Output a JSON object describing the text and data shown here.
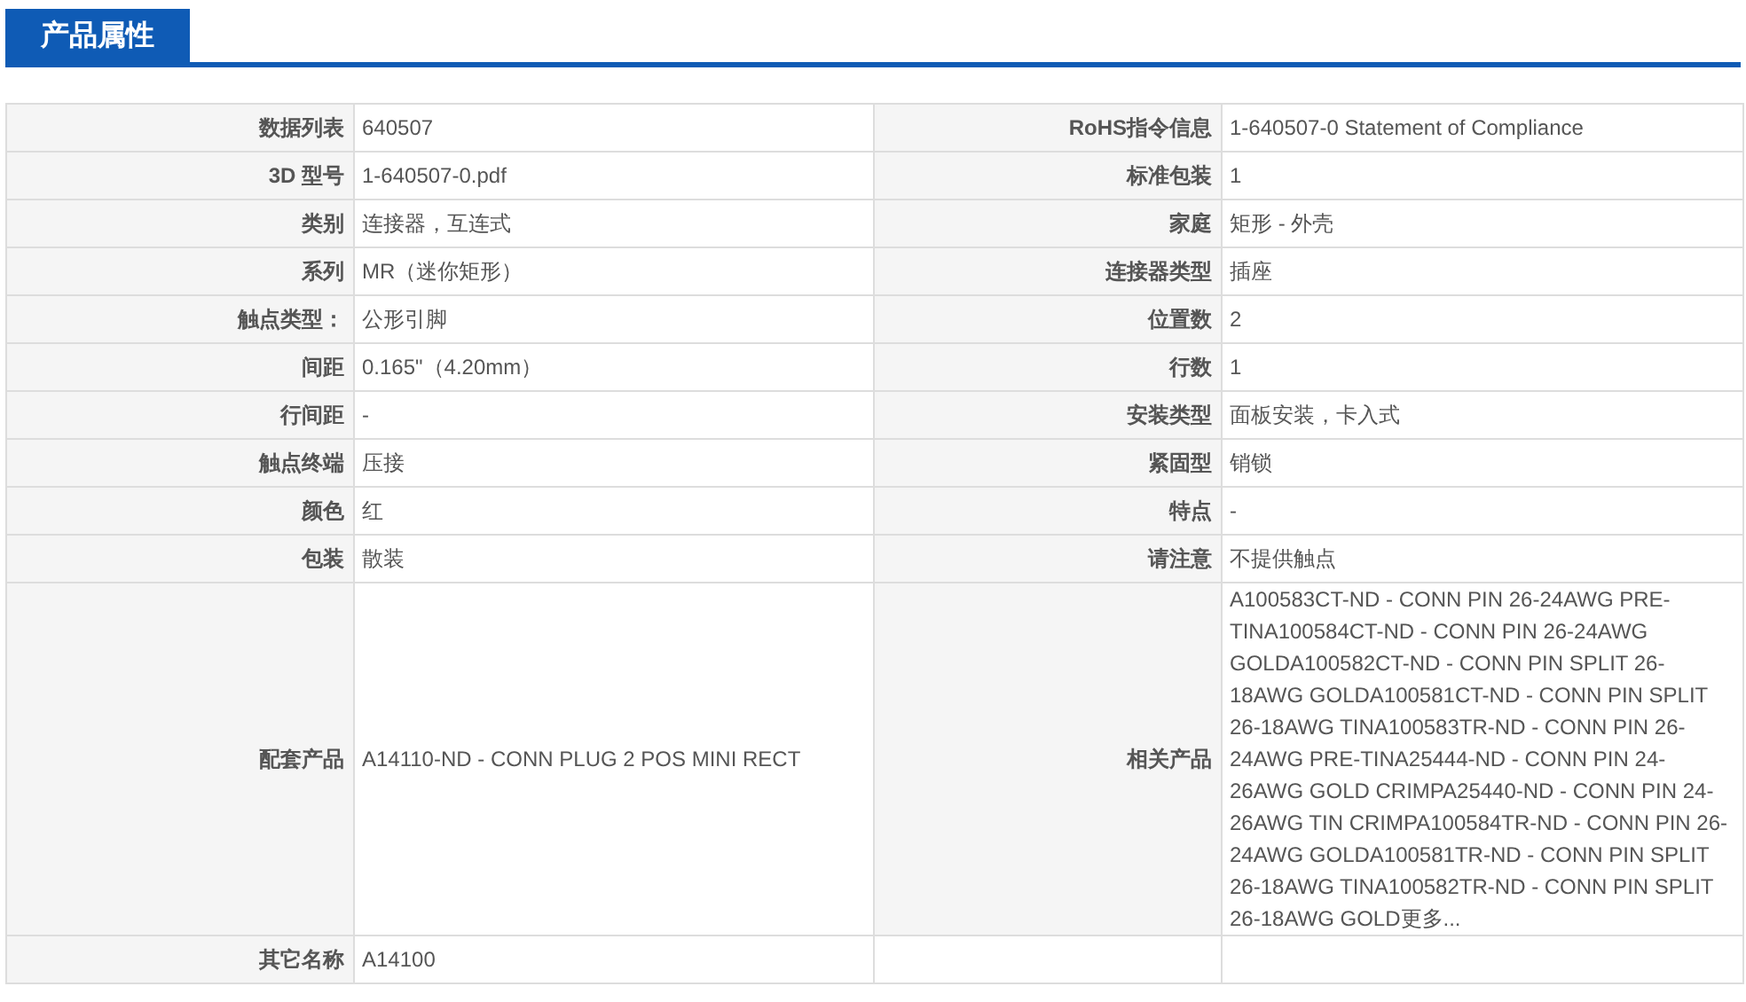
{
  "section_tab": {
    "title": "产品属性"
  },
  "rows": [
    {
      "cells": [
        {
          "label": "数据列表",
          "value": "640507"
        },
        {
          "label": "RoHS指令信息",
          "value": "1-640507-0 Statement of Compliance"
        }
      ]
    },
    {
      "cells": [
        {
          "label": "3D 型号",
          "value": "1-640507-0.pdf"
        },
        {
          "label": "标准包装",
          "value": "1"
        }
      ]
    },
    {
      "cells": [
        {
          "label": "类别",
          "value": "连接器，互连式"
        },
        {
          "label": "家庭",
          "value": "矩形 - 外壳"
        }
      ]
    },
    {
      "cells": [
        {
          "label": "系列",
          "value": "MR（迷你矩形）"
        },
        {
          "label": "连接器类型",
          "value": "插座"
        }
      ]
    },
    {
      "cells": [
        {
          "label": "触点类型：",
          "value": "公形引脚"
        },
        {
          "label": "位置数",
          "value": "2"
        }
      ]
    },
    {
      "cells": [
        {
          "label": "间距",
          "value": "0.165\"（4.20mm）"
        },
        {
          "label": "行数",
          "value": "1"
        }
      ]
    },
    {
      "cells": [
        {
          "label": "行间距",
          "value": "-"
        },
        {
          "label": "安装类型",
          "value": "面板安装，卡入式"
        }
      ]
    },
    {
      "cells": [
        {
          "label": "触点终端",
          "value": "压接"
        },
        {
          "label": "紧固型",
          "value": "销锁"
        }
      ]
    },
    {
      "cells": [
        {
          "label": "颜色",
          "value": "红"
        },
        {
          "label": "特点",
          "value": "-"
        }
      ]
    },
    {
      "cells": [
        {
          "label": "包装",
          "value": "散装"
        },
        {
          "label": "请注意",
          "value": "不提供触点"
        }
      ]
    },
    {
      "cells": [
        {
          "label": "配套产品",
          "value": "A14110-ND - CONN PLUG 2 POS MINI RECT"
        },
        {
          "label": "相关产品",
          "value": "A100583CT-ND - CONN PIN 26-24AWG PRE-TINA100584CT-ND - CONN PIN 26-24AWG GOLDA100582CT-ND - CONN PIN SPLIT 26-18AWG GOLDA100581CT-ND - CONN PIN SPLIT 26-18AWG TINA100583TR-ND - CONN PIN 26-24AWG PRE-TINA25444-ND - CONN PIN 24-26AWG GOLD CRIMPA25440-ND - CONN PIN 24-26AWG TIN CRIMPA100584TR-ND - CONN PIN 26-24AWG GOLDA100581TR-ND - CONN PIN SPLIT 26-18AWG TINA100582TR-ND - CONN PIN SPLIT 26-18AWG GOLD更多..."
        }
      ]
    },
    {
      "cells": [
        {
          "label": "其它名称",
          "value": "A14100"
        }
      ]
    }
  ]
}
